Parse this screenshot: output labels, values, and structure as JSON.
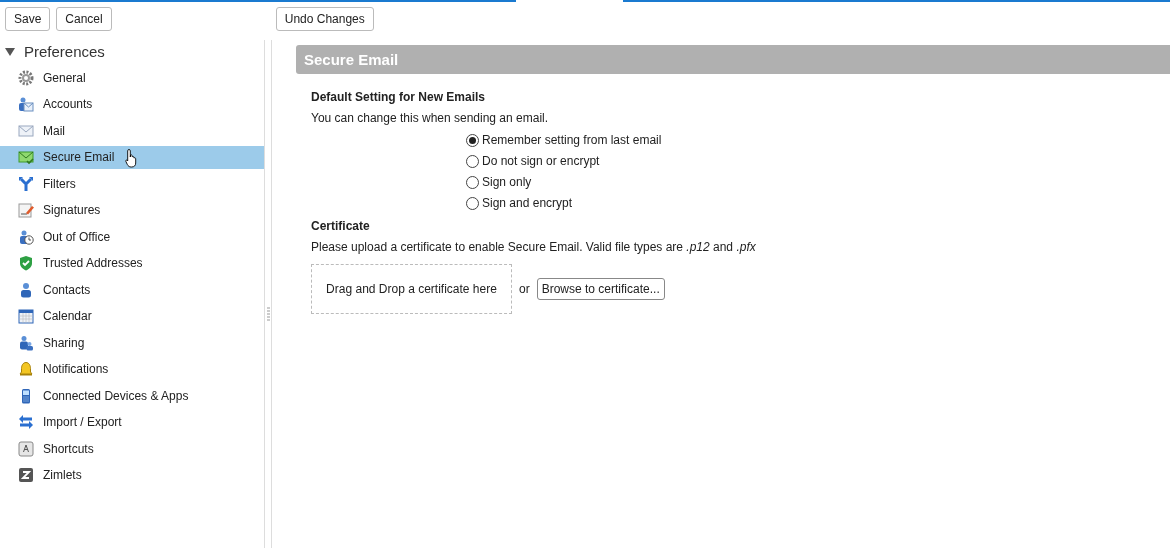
{
  "toolbar": {
    "buttons": [
      "Save",
      "Cancel"
    ],
    "undo_button": "Undo Changes"
  },
  "tree": {
    "label": "Preferences",
    "expanded": true,
    "children": [
      {
        "label": "General",
        "kind": "gear",
        "selected": false
      },
      {
        "label": "Accounts",
        "kind": "accounts",
        "selected": false
      },
      {
        "label": "Mail",
        "kind": "mail",
        "selected": false
      },
      {
        "label": "Secure Email",
        "kind": "secure",
        "selected": true
      },
      {
        "label": "Filters",
        "kind": "filters",
        "selected": false
      },
      {
        "label": "Signatures",
        "kind": "signature",
        "selected": false
      },
      {
        "label": "Out of Office",
        "kind": "away",
        "selected": false
      },
      {
        "label": "Trusted Addresses",
        "kind": "shield",
        "selected": false
      },
      {
        "label": "Contacts",
        "kind": "person",
        "selected": false
      },
      {
        "label": "Calendar",
        "kind": "calendar",
        "selected": false
      },
      {
        "label": "Sharing",
        "kind": "sharing",
        "selected": false
      },
      {
        "label": "Notifications",
        "kind": "bell",
        "selected": false
      },
      {
        "label": "Connected Devices & Apps",
        "kind": "phone",
        "selected": false
      },
      {
        "label": "Import / Export",
        "kind": "arrows",
        "selected": false
      },
      {
        "label": "Shortcuts",
        "kind": "key",
        "selected": false
      },
      {
        "label": "Zimlets",
        "kind": "zimlet",
        "selected": false
      }
    ]
  },
  "section_title": "Secure Email",
  "default_setting": {
    "heading": "Default Setting for New Emails",
    "note": "You can change this when sending an email.",
    "options": [
      {
        "label": "Remember setting from last email",
        "selected": true
      },
      {
        "label": "Do not sign or encrypt",
        "selected": false
      },
      {
        "label": "Sign only",
        "selected": false
      },
      {
        "label": "Sign and encrypt",
        "selected": false
      }
    ]
  },
  "certificate": {
    "heading": "Certificate",
    "note": "Please upload a certificate to enable Secure Email. Valid file types are *.p12* and *.pfx*",
    "drop_zone": "Drag and Drop a certificate here",
    "or": "or",
    "browse_button": "Browse to certificate..."
  }
}
